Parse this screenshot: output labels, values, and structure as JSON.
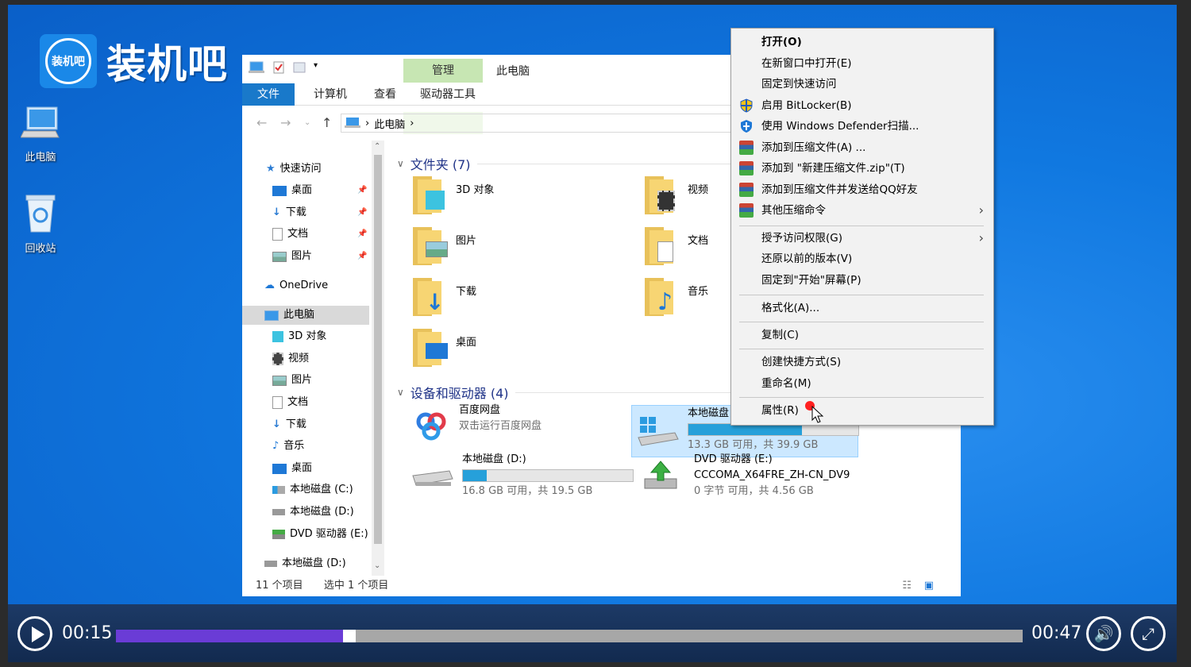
{
  "logo": {
    "badge": "装机吧",
    "name": "装机吧"
  },
  "desktop": {
    "icons": [
      {
        "label": "此电脑"
      },
      {
        "label": "回收站"
      }
    ]
  },
  "explorer": {
    "title": "此电脑",
    "tabs": {
      "file": "文件",
      "computer": "计算机",
      "view": "查看",
      "manage": "管理",
      "drive_tools": "驱动器工具"
    },
    "address": {
      "root": "此电脑"
    },
    "nav": {
      "quick_access": "快速访问",
      "quick": [
        "桌面",
        "下载",
        "文档",
        "图片"
      ],
      "onedrive": "OneDrive",
      "this_pc": "此电脑",
      "pc_items": [
        "3D 对象",
        "视频",
        "图片",
        "文档",
        "下载",
        "音乐",
        "桌面",
        "本地磁盘 (C:)",
        "本地磁盘 (D:)",
        "DVD 驱动器 (E:)"
      ],
      "extra": "本地磁盘 (D:)"
    },
    "folders_header": "文件夹 (7)",
    "folders": [
      "3D 对象",
      "视频",
      "图片",
      "文档",
      "下载",
      "音乐",
      "桌面"
    ],
    "devices_header": "设备和驱动器 (4)",
    "devices": {
      "baidu": {
        "name": "百度网盘",
        "desc": "双击运行百度网盘"
      },
      "c": {
        "name": "本地磁盘",
        "free": "13.3 GB 可用，共 39.9 GB",
        "used_fraction": 0.67
      },
      "d": {
        "name": "本地磁盘 (D:)",
        "free": "16.8 GB 可用，共 19.5 GB",
        "used_fraction": 0.14
      },
      "e": {
        "name": "DVD 驱动器 (E:)",
        "label": "CCCOMA_X64FRE_ZH-CN_DV9",
        "free": "0 字节 可用，共 4.56 GB"
      }
    },
    "status": {
      "count": "11 个项目",
      "selected": "选中 1 个项目"
    }
  },
  "context_menu": {
    "items": [
      {
        "label": "打开(O)",
        "bold": true
      },
      {
        "label": "在新窗口中打开(E)"
      },
      {
        "label": "固定到快速访问"
      },
      {
        "label": "启用 BitLocker(B)",
        "icon": "shield-icon"
      },
      {
        "label": "使用 Windows Defender扫描...",
        "icon": "defender-icon"
      },
      {
        "label": "添加到压缩文件(A) ...",
        "icon": "winrar-icon"
      },
      {
        "label": "添加到 \"新建压缩文件.zip\"(T)",
        "icon": "winrar-icon"
      },
      {
        "label": "添加到压缩文件并发送给QQ好友",
        "icon": "winrar-icon"
      },
      {
        "label": "其他压缩命令",
        "icon": "winrar-icon",
        "submenu": true
      },
      {
        "label": "授予访问权限(G)",
        "submenu": true
      },
      {
        "label": "还原以前的版本(V)"
      },
      {
        "label": "固定到\"开始\"屏幕(P)"
      },
      {
        "label": "格式化(A)..."
      },
      {
        "label": "复制(C)"
      },
      {
        "label": "创建快捷方式(S)"
      },
      {
        "label": "重命名(M)"
      },
      {
        "label": "属性(R)"
      }
    ],
    "arrow": "›"
  },
  "player": {
    "current": "00:15",
    "total": "00:47",
    "progress": 0.25
  },
  "colors": {
    "desktop": "#1078e0",
    "file_tab": "#1979ca",
    "manage_tab": "#c7e6b3",
    "progress": "#6a3cd6",
    "drive_bar": "#26a0da"
  }
}
